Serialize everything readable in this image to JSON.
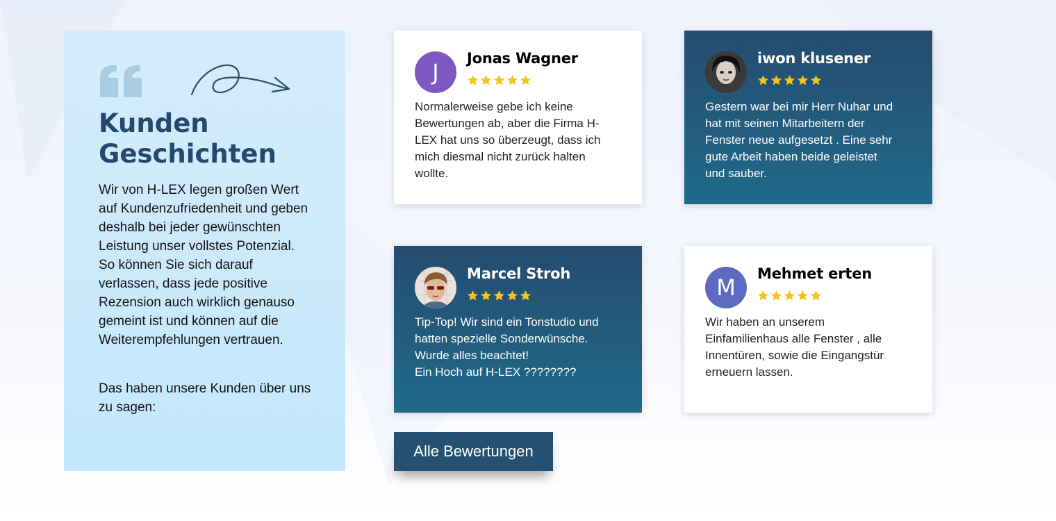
{
  "intro": {
    "title": "Kunden\nGeschichten",
    "text": "Wir von H-LEX legen großen Wert auf Kundenzufriedenheit und geben deshalb bei jeder gewünschten Leistung unser vollstes Potenzial. So können Sie sich darauf verlassen, dass jede positive Rezension auch wirklich genauso gemeint ist und können auf die Weiterempfehlungen vertrauen.",
    "cta": "Das haben unsere Kunden über uns zu sagen:"
  },
  "reviews": [
    {
      "name": "Jonas Wagner",
      "initial": "J",
      "avatar_color": "#7e57c2",
      "rating": 5,
      "theme": "light",
      "text": "Normalerweise gebe ich keine\nBewertungen ab, aber die Firma H-\nLEX hat uns so überzeugt, dass ich\nmich diesmal nicht zurück halten\nwollte."
    },
    {
      "name": "iwon klusener",
      "initial": "",
      "avatar_color": "#2b2b2b",
      "rating": 5,
      "theme": "dark",
      "text": "Gestern war bei mir Herr Nuhar und\nhat mit seinen Mitarbeitern der\nFenster neue aufgesetzt . Eine sehr\ngute Arbeit haben beide geleistet\nund sauber."
    },
    {
      "name": "Marcel Stroh",
      "initial": "",
      "avatar_color": "#c9a98a",
      "rating": 5,
      "theme": "dark",
      "text": "Tip-Top! Wir sind ein Tonstudio und\nhatten spezielle Sonderwünsche.\nWurde alles beachtet!\nEin Hoch auf H-LEX ????????"
    },
    {
      "name": "Mehmet erten",
      "initial": "M",
      "avatar_color": "#5c6bc0",
      "rating": 5,
      "theme": "light",
      "text": "Wir haben an unserem\nEinfamilienhaus alle Fenster , alle\nInnentüren, sowie die Eingangstür\nerneuern lassen."
    }
  ],
  "button": {
    "all_reviews_label": "Alle Bewertungen"
  },
  "colors": {
    "panel_bg": "#c3e8fd",
    "title": "#234a6e",
    "dark_card": "#225876",
    "star": "#f5c518",
    "button_bg": "#26506f"
  },
  "icons": {
    "quote": "quote-icon",
    "arrow": "curly-arrow-icon",
    "star": "star-icon"
  }
}
